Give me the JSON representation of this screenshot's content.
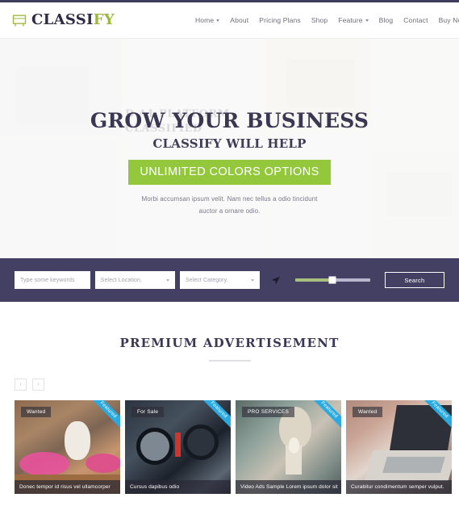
{
  "header": {
    "logo": {
      "icon": "shop-awning-icon",
      "text_primary": "CLASSI",
      "text_accent": "FY"
    },
    "nav": [
      {
        "label": "Home",
        "caret": true
      },
      {
        "label": "About",
        "caret": false
      },
      {
        "label": "Pricing Plans",
        "caret": false
      },
      {
        "label": "Shop",
        "caret": false
      },
      {
        "label": "Feature",
        "caret": true
      },
      {
        "label": "Blog",
        "caret": false
      },
      {
        "label": "Contact",
        "caret": false
      },
      {
        "label": "Buy Now",
        "caret": false
      }
    ]
  },
  "hero": {
    "ghost_line1": "D A1 PLATFORM",
    "ghost_line2": "CLASSIFIED",
    "heading": "GROW YOUR BUSINESS",
    "subheading": "CLASSIFY WILL HELP",
    "button_label": "UNLIMITED COLORS OPTIONS",
    "paragraph_line1": "Morbi accumsan ipsum velit. Nam nec tellus a odio tincidunt",
    "paragraph_line2": "auctor a ornare odio."
  },
  "search": {
    "keyword_placeholder": "Type some keywords",
    "location_value": "Select Location.",
    "category_value": "Select Category.",
    "geo_icon": "location-arrow-icon",
    "slider_percent": 50,
    "button_label": "Search"
  },
  "premium": {
    "title": "PREMIUM ADVERTISEMENT",
    "prev_label": "‹",
    "next_label": "›",
    "ribbon_label": "Featured",
    "cards": [
      {
        "badge": "Wanted",
        "caption": "Donec tempor id risus vel ullamcorper",
        "featured": true,
        "image": "cat-in-pink-bed-photo"
      },
      {
        "badge": "For Sale",
        "caption": "Cursus dapibus odio",
        "featured": true,
        "image": "car-dashboard-photo"
      },
      {
        "badge": "PRO SERVICES",
        "caption": "Video Ads Sample Lorem ipsum dolor sit",
        "featured": true,
        "image": "person-holding-ice-cream-photo"
      },
      {
        "badge": "Wanted",
        "caption": "Curabitur condimentum semper vulput.",
        "featured": true,
        "image": "laptop-on-desk-photo"
      }
    ]
  },
  "colors": {
    "brand_navy": "#434063",
    "brand_green": "#93c83d",
    "accent_blue": "#29abe2",
    "text_dark": "#3b3855"
  }
}
